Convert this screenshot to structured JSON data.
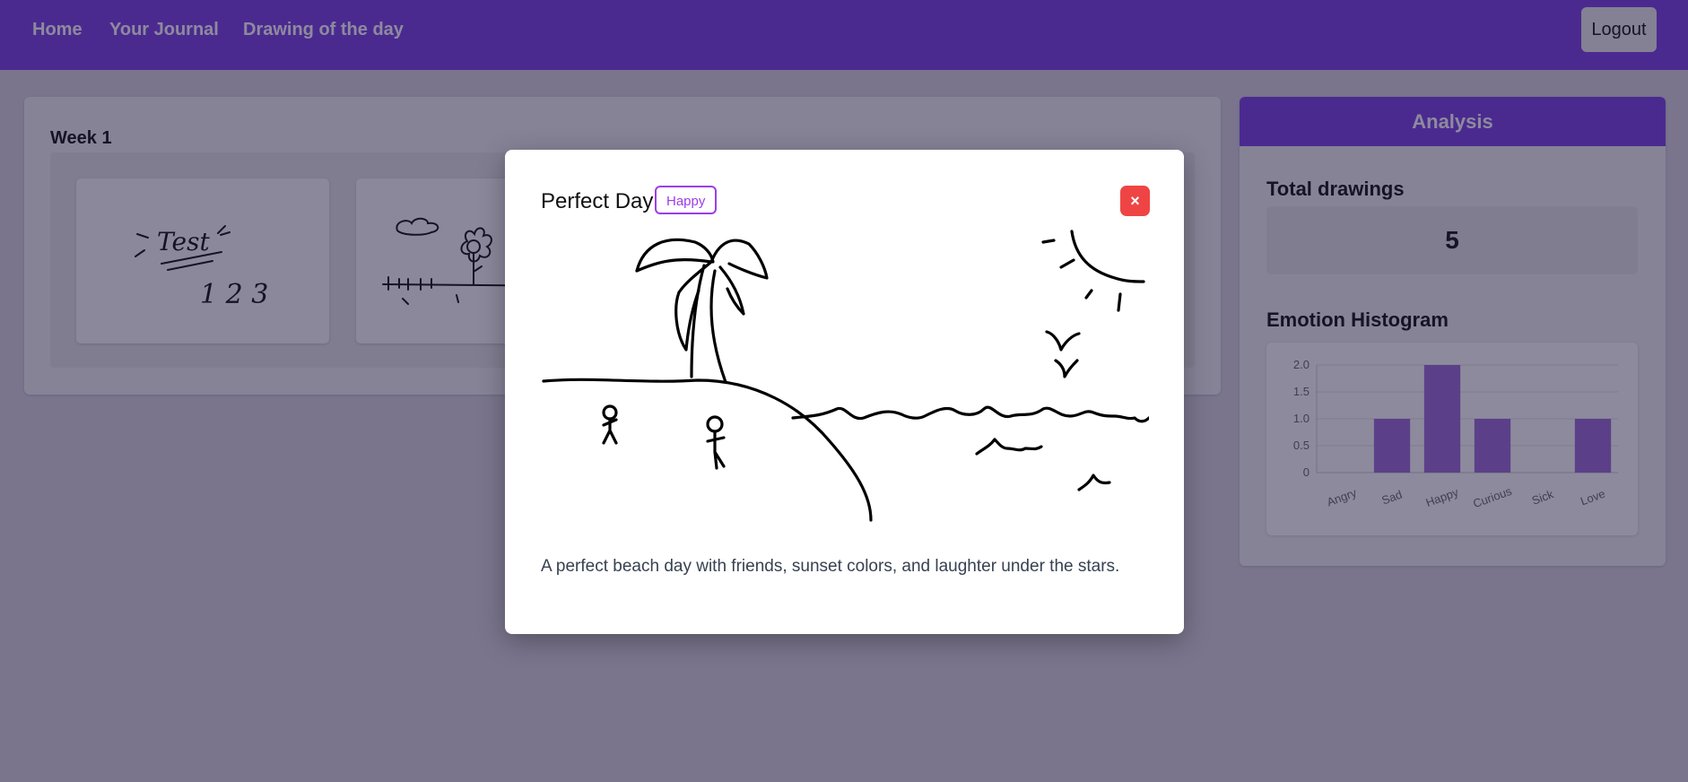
{
  "nav": {
    "links": [
      "Home",
      "Your Journal",
      "Drawing of the day"
    ],
    "logout_label": "Logout"
  },
  "journal": {
    "week_title": "Week 1",
    "thumb_test": {
      "title": "Test",
      "numbers": "1 2 3"
    }
  },
  "analysis": {
    "header": "Analysis",
    "total_title": "Total drawings",
    "total_value": "5",
    "histogram_title": "Emotion Histogram"
  },
  "chart_data": {
    "type": "bar",
    "categories": [
      "Angry",
      "Sad",
      "Happy",
      "Curious",
      "Sick",
      "Love"
    ],
    "values": [
      0,
      1,
      2,
      1,
      0,
      1
    ],
    "yticks": [
      "0",
      "0.5",
      "1.0",
      "1.5",
      "2.0"
    ],
    "ylim": [
      0,
      2
    ],
    "grid": true,
    "bar_color": "#9b6bd6"
  },
  "modal": {
    "title": "Perfect Day",
    "emotion": "Happy",
    "close_label": "×",
    "description": "A perfect beach day with friends, sunset colors, and laughter under the stars."
  },
  "colors": {
    "primary": "#7a3fe4",
    "badge": "#9a3ee8",
    "close": "#ef4444"
  }
}
